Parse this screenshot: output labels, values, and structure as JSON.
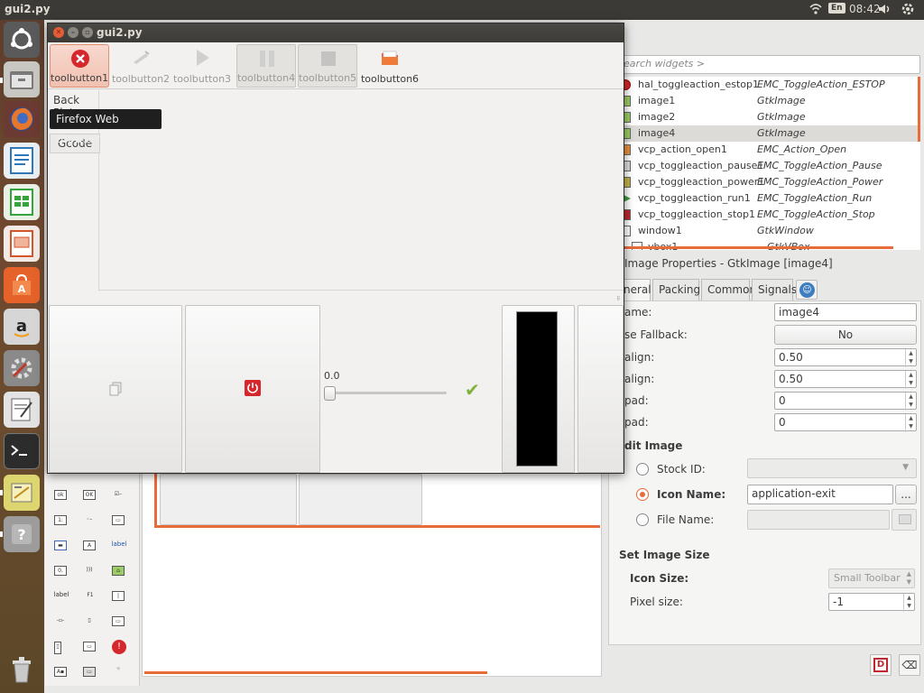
{
  "topbar": {
    "app_title": "gui2.py",
    "lang": "En",
    "clock": "08:42"
  },
  "launcher": {
    "items": [
      {
        "name": "ubuntu-dash",
        "color": "#6f6f6f"
      },
      {
        "name": "files",
        "color": "#8a8a8a"
      },
      {
        "name": "firefox",
        "color": "#e3782d"
      },
      {
        "name": "writer",
        "color": "#2f77b8"
      },
      {
        "name": "calc",
        "color": "#35a43a"
      },
      {
        "name": "impress",
        "color": "#d5552b"
      },
      {
        "name": "software-center",
        "color": "#e5632b"
      },
      {
        "name": "amazon",
        "color": "#b3b3b3"
      },
      {
        "name": "settings",
        "color": "#8b8b8b"
      },
      {
        "name": "text-editor",
        "color": "#d8d8d8"
      },
      {
        "name": "terminal",
        "color": "#3a3a3a"
      },
      {
        "name": "glade",
        "color": "#d8d06a"
      },
      {
        "name": "help",
        "color": "#9a9a9a"
      },
      {
        "name": "trash",
        "color": "#9a9a9a"
      }
    ]
  },
  "tooltip": "Firefox Web Browser",
  "window": {
    "title": "gui2.py",
    "toolbar": [
      {
        "label": "toolbutton1",
        "icon": "stop-icon"
      },
      {
        "label": "toolbutton2",
        "icon": "open-icon"
      },
      {
        "label": "toolbutton3",
        "icon": "run-icon"
      },
      {
        "label": "toolbutton4",
        "icon": "pause-icon"
      },
      {
        "label": "toolbutton5",
        "icon": "square-icon"
      },
      {
        "label": "toolbutton6",
        "icon": "folder-icon"
      }
    ],
    "notebook": {
      "tab1": "Back Plot",
      "tab2": "Gcode"
    },
    "slider_value": "0.0"
  },
  "widget_search": {
    "placeholder": "earch widgets >"
  },
  "widget_tree": [
    {
      "name": "hal_toggleaction_estop1",
      "type": "EMC_ToggleAction_ESTOP",
      "icon": "estop-icon"
    },
    {
      "name": "image1",
      "type": "GtkImage",
      "icon": "image-icon"
    },
    {
      "name": "image2",
      "type": "GtkImage",
      "icon": "image-icon"
    },
    {
      "name": "image4",
      "type": "GtkImage",
      "icon": "image-icon",
      "selected": true
    },
    {
      "name": "vcp_action_open1",
      "type": "EMC_Action_Open",
      "icon": "open-icon"
    },
    {
      "name": "vcp_toggleaction_pause1",
      "type": "EMC_ToggleAction_Pause",
      "icon": "pause-icon"
    },
    {
      "name": "vcp_toggleaction_power1",
      "type": "EMC_ToggleAction_Power",
      "icon": "power-icon"
    },
    {
      "name": "vcp_toggleaction_run1",
      "type": "EMC_ToggleAction_Run",
      "icon": "run-icon"
    },
    {
      "name": "vcp_toggleaction_stop1",
      "type": "EMC_ToggleAction_Stop",
      "icon": "stop-icon"
    },
    {
      "name": "window1",
      "type": "GtkWindow",
      "icon": "window-icon"
    },
    {
      "name": "vbox1",
      "type": "GtkVBox",
      "icon": "vbox-icon"
    }
  ],
  "properties": {
    "title": "Image Properties - GtkImage [image4]",
    "tabs": [
      "neral",
      "Packing",
      "Common",
      "Signals"
    ],
    "name_label": "ame:",
    "name_value": "image4",
    "fallback_label": "se Fallback:",
    "fallback_value": "No",
    "xalign_label": "align:",
    "xalign_value": "0.50",
    "yalign_label": "align:",
    "yalign_value": "0.50",
    "xpad_label": "pad:",
    "xpad_value": "0",
    "ypad_label": "pad:",
    "ypad_value": "0",
    "edit_image_header": "dit Image",
    "stock_label": "Stock ID:",
    "icon_name_label": "Icon Name:",
    "icon_name_value": "application-exit",
    "file_name_label": "File Name:",
    "set_size_header": "Set Image Size",
    "icon_size_label": "Icon Size:",
    "icon_size_value": "Small Toolbar",
    "pixel_size_label": "Pixel size:",
    "pixel_size_value": "-1",
    "browse_label": "..."
  },
  "palette_labels": {
    "label1": "label",
    "label2": "label",
    "f1": "F1",
    "a": "A",
    "ok": "OK"
  },
  "colors": {
    "accent": "#e86b3a",
    "stop_red": "#d5272c",
    "titlebar": "#3c3b37"
  }
}
